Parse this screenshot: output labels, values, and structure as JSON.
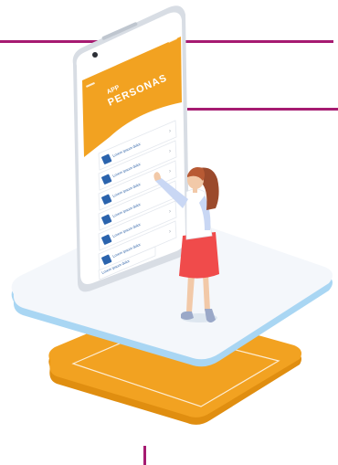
{
  "phone": {
    "screen_title_small": "APP",
    "screen_title_large": "PERSONAS"
  },
  "colors": {
    "accent_line": "#a61b71",
    "orange": "#f2a221",
    "platform_top": "#f4f7fb",
    "platform_edge": "#a9d6f3",
    "item_icon": "#2a63ad"
  },
  "menu_items": [
    {
      "label": "Lorem ipsum dolor"
    },
    {
      "label": "Lorem ipsum dolor"
    },
    {
      "label": "Lorem ipsum dolor"
    },
    {
      "label": "Lorem ipsum dolor"
    },
    {
      "label": "Lorem ipsum dolor"
    },
    {
      "label": "Lorem ipsum dolor"
    },
    {
      "label": "Lorem ipsum dolor"
    }
  ]
}
